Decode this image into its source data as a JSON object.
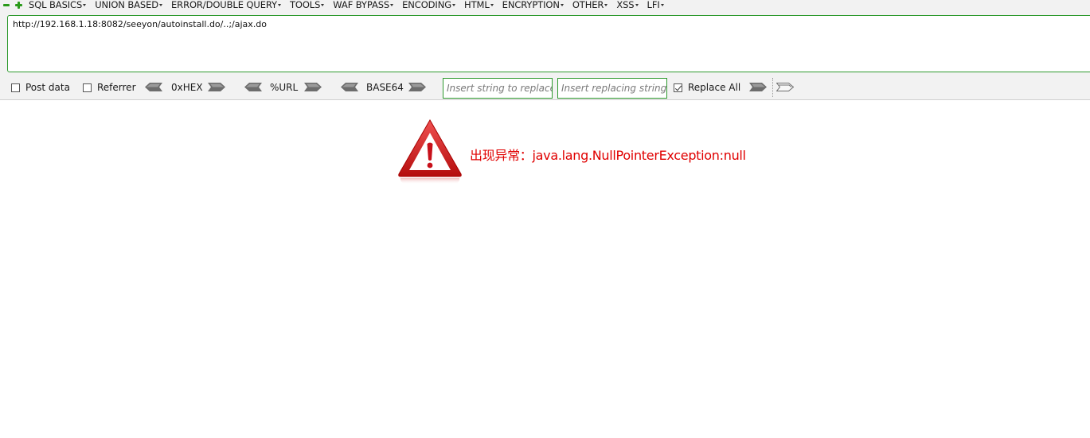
{
  "menubar": {
    "items": [
      {
        "label": "SQL BASICS"
      },
      {
        "label": "UNION BASED"
      },
      {
        "label": "ERROR/DOUBLE QUERY"
      },
      {
        "label": "TOOLS"
      },
      {
        "label": "WAF BYPASS"
      },
      {
        "label": "ENCODING"
      },
      {
        "label": "HTML"
      },
      {
        "label": "ENCRYPTION"
      },
      {
        "label": "OTHER"
      },
      {
        "label": "XSS"
      },
      {
        "label": "LFI"
      }
    ]
  },
  "url_field": {
    "value": "http://192.168.1.18:8082/seeyon/autoinstall.do/..;/ajax.do"
  },
  "toolbar": {
    "post_data_label": "Post data",
    "post_data_checked": false,
    "referrer_label": "Referrer",
    "referrer_checked": false,
    "hex_label": "0xHEX",
    "url_label": "%URL",
    "base64_label": "BASE64",
    "insert_string_placeholder": "Insert string to replace",
    "insert_replacing_placeholder": "Insert replacing string",
    "replace_all_label": "Replace All",
    "replace_all_checked": true
  },
  "page": {
    "error_message": "出现异常：java.lang.NullPointerException:null",
    "accent_color": "#e00000",
    "icon": "warning-triangle-icon"
  }
}
